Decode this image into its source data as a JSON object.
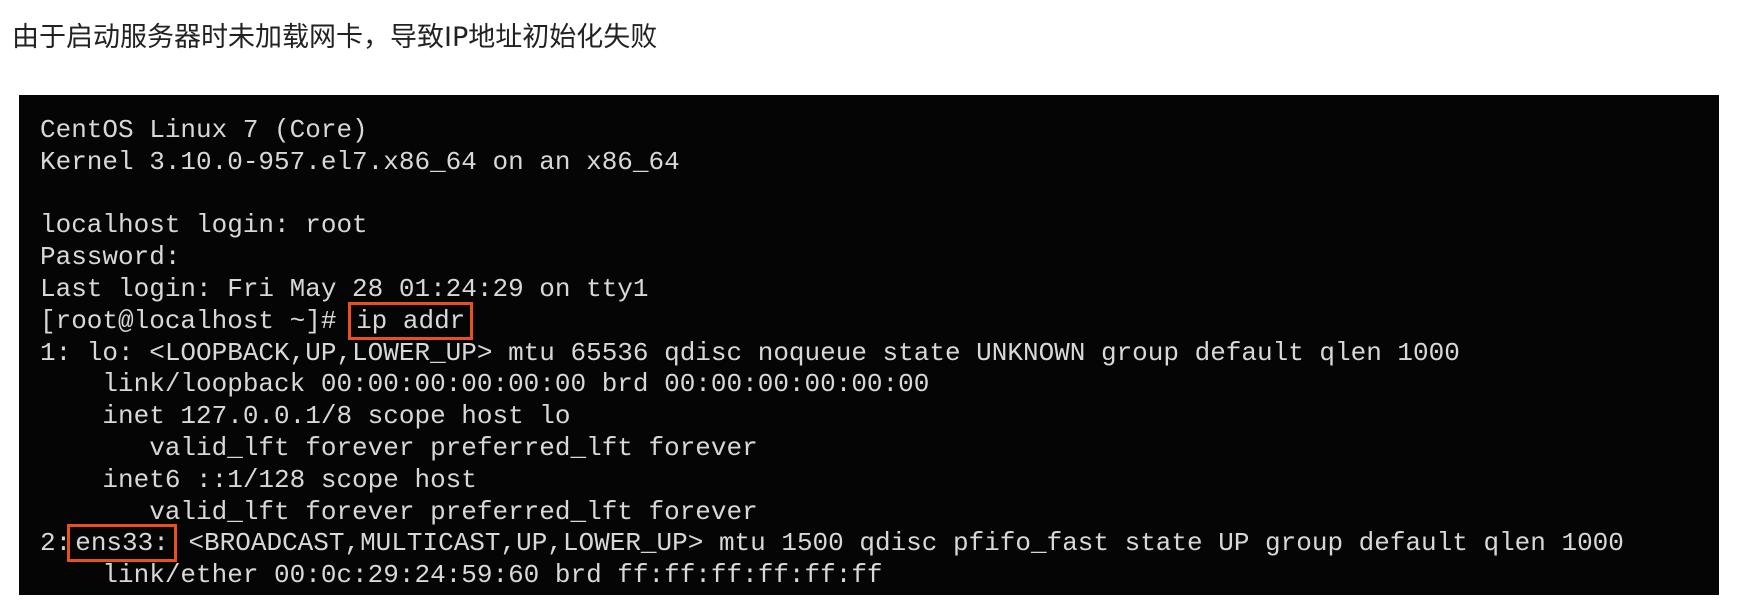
{
  "caption": "由于启动服务器时未加载网卡，导致IP地址初始化失败",
  "terminal": {
    "line1": "CentOS Linux 7 (Core)",
    "line2": "Kernel 3.10.0-957.el7.x86_64 on an x86_64",
    "line3": "",
    "line4": "localhost login: root",
    "line5": "Password:",
    "line6": "Last login: Fri May 28 01:24:29 on tty1",
    "line7_prompt": "[root@localhost ~]#",
    "line7_command": "ip addr",
    "line8": "1: lo: <LOOPBACK,UP,LOWER_UP> mtu 65536 qdisc noqueue state UNKNOWN group default qlen 1000",
    "line9": "    link/loopback 00:00:00:00:00:00 brd 00:00:00:00:00:00",
    "line10": "    inet 127.0.0.1/8 scope host lo",
    "line11": "       valid_lft forever preferred_lft forever",
    "line12": "    inet6 ::1/128 scope host",
    "line13": "       valid_lft forever preferred_lft forever",
    "line14_prefix": "2:",
    "line14_iface": "ens33:",
    "line14_rest": "<BROADCAST,MULTICAST,UP,LOWER_UP> mtu 1500 qdisc pfifo_fast state UP group default qlen 1000",
    "line15": "    link/ether 00:0c:29:24:59:60 brd ff:ff:ff:ff:ff:ff"
  },
  "colors": {
    "terminal_bg": "#050505",
    "terminal_text": "#d8d8d8",
    "highlight_box": "#e8501f"
  }
}
